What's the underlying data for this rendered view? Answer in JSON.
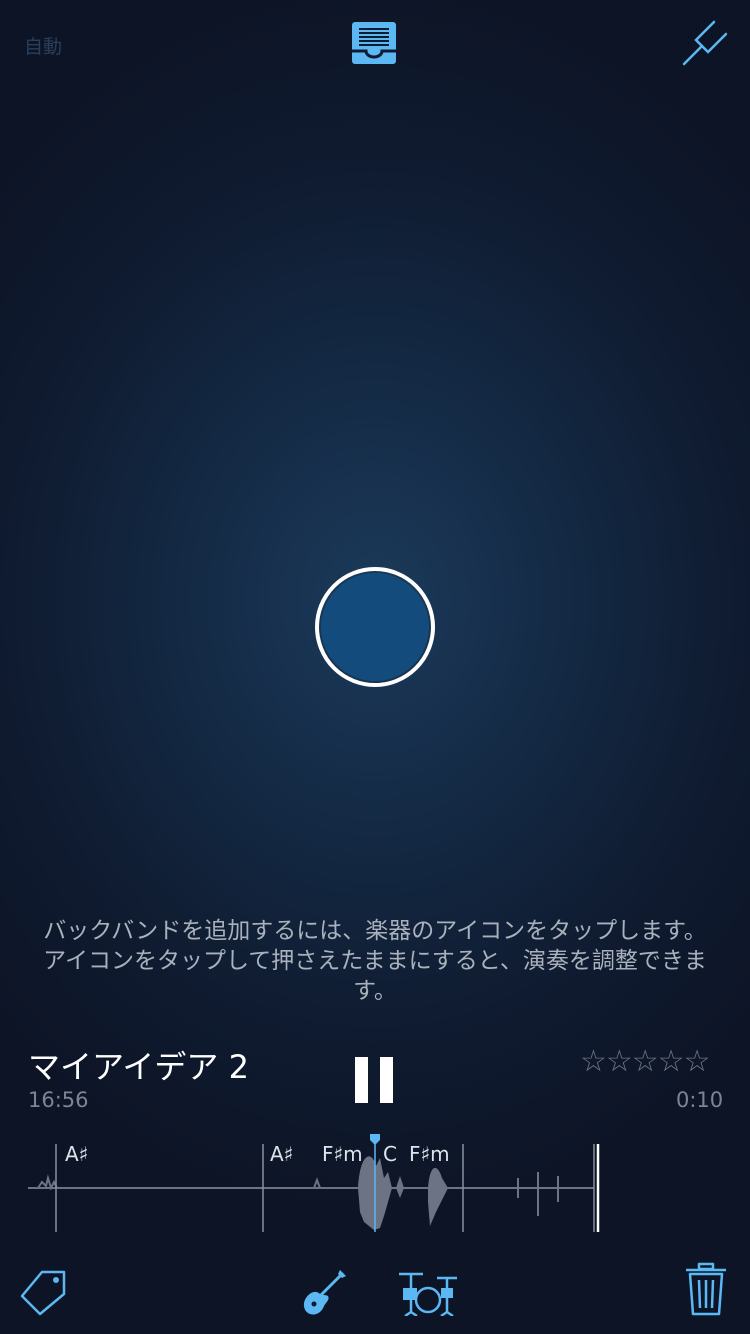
{
  "header": {
    "auto_label": "自動",
    "icons": {
      "inbox": "inbox-icon",
      "tuner": "tuning-fork-icon"
    }
  },
  "record": {
    "icon": "record-icon",
    "color": "#134c7c"
  },
  "hint": {
    "text": "バックバンドを追加するには、楽器のアイコンをタップします。アイコンをタップして押さえたままにすると、演奏を調整できます。"
  },
  "player": {
    "title": "マイアイデア 2",
    "time": "16:56",
    "rating_display": "☆☆☆☆☆",
    "rating": 0,
    "elapsed": "0:10"
  },
  "chords": [
    "A♯",
    "A♯",
    "F♯m",
    "C",
    "F♯m"
  ],
  "toolbar": {
    "icons": [
      "tag-icon",
      "guitar-icon",
      "drums-icon",
      "trash-icon"
    ]
  },
  "colors": {
    "accent": "#5bb8f2",
    "record_fill": "#134c7c",
    "waveform": "#6b7384"
  }
}
